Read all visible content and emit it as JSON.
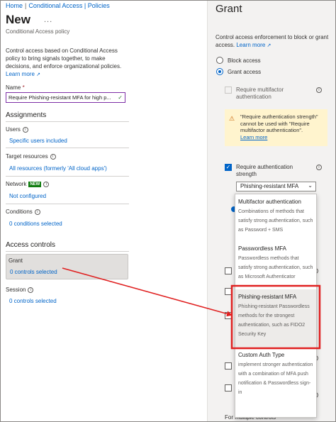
{
  "breadcrumb": [
    "Home",
    "Conditional Access | Policies"
  ],
  "header": {
    "title": "New",
    "more": "...",
    "subtitle": "Conditional Access policy"
  },
  "description": {
    "text": "Control access based on Conditional Access policy to bring signals together, to make decisions, and enforce organizational policies.",
    "learn_more": "Learn more"
  },
  "name_field": {
    "label": "Name",
    "required_mark": "*",
    "value": "Require Phishing-resistant MFA for high p..."
  },
  "assignments": {
    "heading": "Assignments",
    "users": {
      "label": "Users",
      "value": "Specific users included"
    },
    "target_resources": {
      "label": "Target resources",
      "value": "All resources (formerly 'All cloud apps')"
    },
    "network": {
      "label": "Network",
      "badge": "NEW",
      "value": "Not configured"
    },
    "conditions": {
      "label": "Conditions",
      "value": "0 conditions selected"
    }
  },
  "access_controls": {
    "heading": "Access controls",
    "grant": {
      "label": "Grant",
      "value": "0 controls selected"
    },
    "session": {
      "label": "Session",
      "value": "0 controls selected"
    }
  },
  "grant_panel": {
    "title": "Grant",
    "description": "Control access enforcement to block or grant access.",
    "learn_more": "Learn more",
    "options": [
      {
        "label": "Block access",
        "selected": false
      },
      {
        "label": "Grant access",
        "selected": true
      }
    ],
    "require_mfa": {
      "label": "Require multifactor authentication",
      "checked": false,
      "disabled": true
    },
    "warning": {
      "text": "\"Require authentication strength\" cannot be used with \"Require multifactor authentication\".",
      "learn_more": "Learn more"
    },
    "require_strength": {
      "label": "Require authentication strength",
      "checked": true
    },
    "strength_dropdown": {
      "value": "Phishing-resistant MFA"
    },
    "for_multiple": "For multiple controls"
  },
  "strength_options": [
    {
      "title": "Multifactor authentication",
      "desc": "Combinations of methods that satisfy strong authentication, such as Password + SMS",
      "selected": false
    },
    {
      "title": "Passwordless MFA",
      "desc": "Passwordless methods that satisfy strong authentication, such as Microsoft Authenticator",
      "selected": false
    },
    {
      "title": "Phishing-resistant MFA",
      "desc": "Phishing-resistant Passwordless methods for the strongest authentication, such as FIDO2 Security Key",
      "selected": true
    },
    {
      "title": "Custom Auth Type",
      "desc": "implement stronger authentication with a combination of MFA push notification & Passwordless sign-in",
      "selected": false
    }
  ],
  "colors": {
    "link": "#0064c8",
    "annotation": "#e02020",
    "new_badge": "#107c10",
    "warning_bg": "#fff4ce"
  }
}
